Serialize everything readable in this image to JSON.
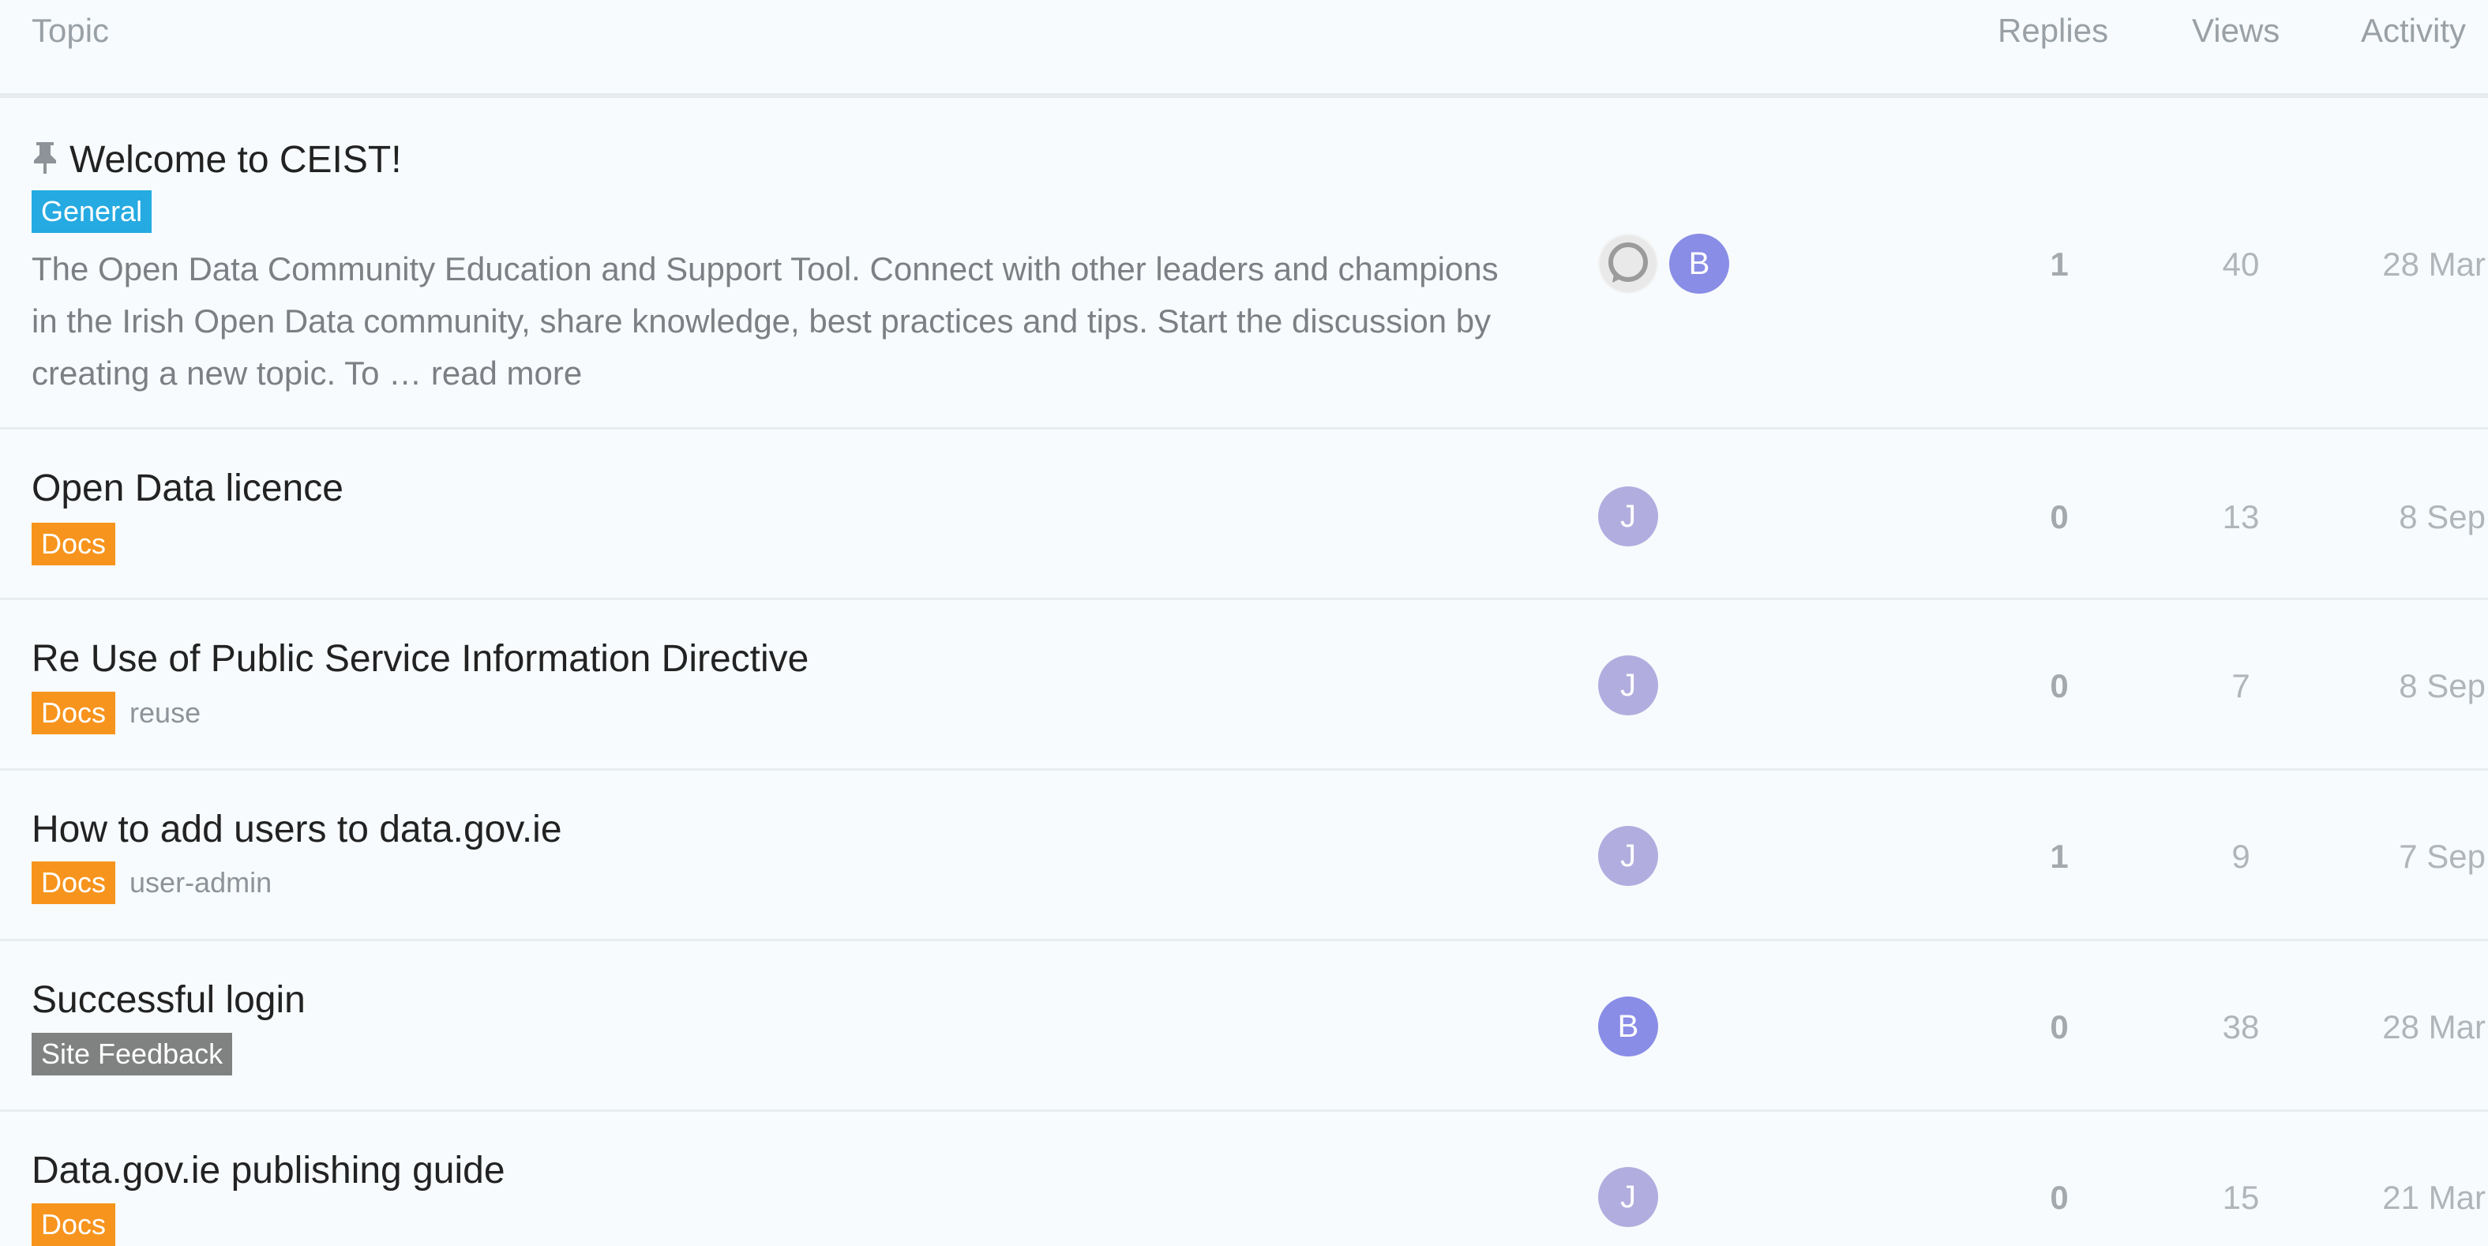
{
  "header": {
    "topic": "Topic",
    "replies": "Replies",
    "views": "Views",
    "activity": "Activity"
  },
  "colors": {
    "general": "#25aae1",
    "docs": "#f7941d",
    "site_feedback": "#808281"
  },
  "topics": [
    {
      "title": "Welcome to CEIST!",
      "pinned": true,
      "category": "General",
      "tag": "",
      "excerpt": "The Open Data Community Education and Support Tool. Connect with other leaders and champions in the Irish Open Data community, share knowledge, best practices and tips. Start the discussion by creating a new topic. To …",
      "read_more": "read more",
      "avatars": [
        "system",
        "B"
      ],
      "replies": "1",
      "views": "40",
      "activity": "28 Mar"
    },
    {
      "title": "Open Data licence",
      "category": "Docs",
      "tag": "",
      "avatars": [
        "J"
      ],
      "replies": "0",
      "views": "13",
      "activity": "8 Sep"
    },
    {
      "title": "Re Use of Public Service Information Directive",
      "category": "Docs",
      "tag": "reuse",
      "avatars": [
        "J"
      ],
      "replies": "0",
      "views": "7",
      "activity": "8 Sep"
    },
    {
      "title": "How to add users to data.gov.ie",
      "category": "Docs",
      "tag": "user-admin",
      "avatars": [
        "J"
      ],
      "replies": "1",
      "views": "9",
      "activity": "7 Sep"
    },
    {
      "title": "Successful login",
      "category": "Site Feedback",
      "tag": "",
      "avatars": [
        "B"
      ],
      "replies": "0",
      "views": "38",
      "activity": "28 Mar"
    },
    {
      "title": "Data.gov.ie publishing guide",
      "category": "Docs",
      "tag": "",
      "avatars": [
        "J"
      ],
      "replies": "0",
      "views": "15",
      "activity": "21 Mar"
    }
  ]
}
